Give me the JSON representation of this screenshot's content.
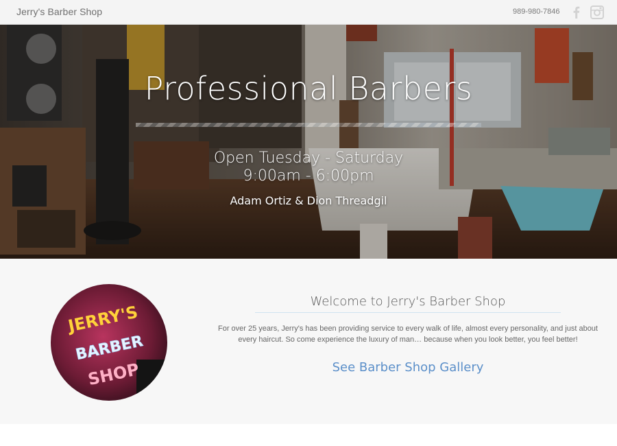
{
  "header": {
    "brand": "Jerry's Barber Shop",
    "phone": "989-980-7846",
    "social": [
      {
        "name": "facebook-icon"
      },
      {
        "name": "instagram-icon"
      }
    ],
    "icon_color": "#cfcfcf"
  },
  "hero": {
    "title": "Professional Barbers",
    "hours_line1": "Open Tuesday - Saturday",
    "hours_line2": "9:00am - 6:00pm",
    "barbers": "Adam Ortiz & Dion Threadgil"
  },
  "welcome": {
    "title": "Welcome to Jerry's Barber Shop",
    "text": "For over 25 years, Jerry's has been providing service to every walk of life, almost every personality, and just about every haircut. So come experience the luxury of man… because when you look better, you feel better!",
    "gallery_link": "See Barber Shop Gallery",
    "neon_sign": {
      "line1": "JERRY'S",
      "line2": "BARBER",
      "line3": "SHOP"
    },
    "link_color": "#5b8fc9"
  }
}
